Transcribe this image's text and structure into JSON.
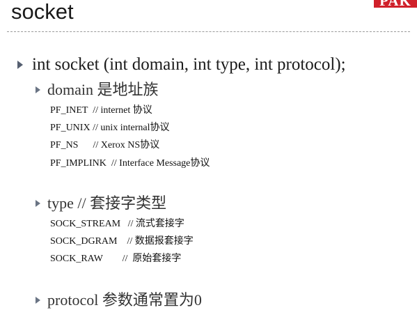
{
  "slide": {
    "title": "socket",
    "logo_text": "PAK"
  },
  "main_bullet": {
    "text": "int socket (int domain, int type, int protocol);"
  },
  "sections": {
    "domain": {
      "heading": "domain 是地址族",
      "lines": [
        "PF_INET  // internet 协议",
        "PF_UNIX // unix internal协议",
        "PF_NS      // Xerox NS协议",
        "PF_IMPLINK  // Interface Message协议"
      ]
    },
    "type": {
      "heading": "type  // 套接字类型",
      "lines": [
        "SOCK_STREAM   // 流式套接字",
        "SOCK_DGRAM    // 数据报套接字",
        "SOCK_RAW        //  原始套接字"
      ]
    },
    "protocol": {
      "heading": "protocol 参数通常置为0"
    }
  },
  "colors": {
    "logo_background": "#d0202a",
    "bullet": "#555f70",
    "text": "#1a1a1a"
  }
}
